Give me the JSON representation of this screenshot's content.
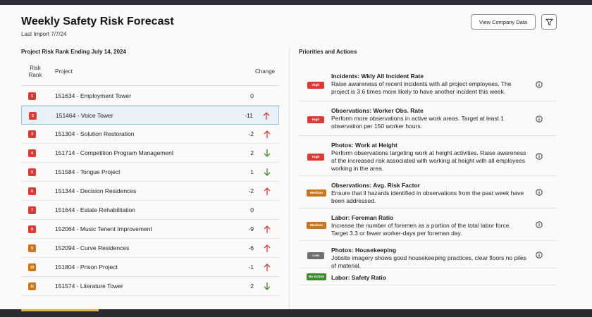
{
  "header": {
    "title": "Weekly Safety Risk Forecast",
    "subtitle": "Last Import 7/7/24",
    "company_button": "View Company Data",
    "filter_icon": "filter-icon"
  },
  "left": {
    "title": "Project Risk Rank Ending July 14, 2024",
    "col_rank_line1": "Risk",
    "col_rank_line2": "Rank",
    "col_project": "Project",
    "col_change": "Change",
    "rows": [
      {
        "rank": "1",
        "project": "151634 - Employment Tower",
        "change": "0",
        "trend": "none",
        "color": "#d93b36"
      },
      {
        "rank": "2",
        "project": "151464 - Voice Tower",
        "change": "-11",
        "trend": "up",
        "color": "#d93b36"
      },
      {
        "rank": "3",
        "project": "151304 - Solution Restoration",
        "change": "-2",
        "trend": "up",
        "color": "#d93b36"
      },
      {
        "rank": "4",
        "project": "151714 - Competition Program Management",
        "change": "2",
        "trend": "down",
        "color": "#d93b36"
      },
      {
        "rank": "5",
        "project": "151584 - Tongue Project",
        "change": "1",
        "trend": "down",
        "color": "#d93b36"
      },
      {
        "rank": "6",
        "project": "151344 - Decision Residences",
        "change": "-2",
        "trend": "up",
        "color": "#d93b36"
      },
      {
        "rank": "7",
        "project": "151644 - Estate Rehabilitation",
        "change": "0",
        "trend": "none",
        "color": "#d93b36"
      },
      {
        "rank": "8",
        "project": "152064 - Music Tenent Improvement",
        "change": "-9",
        "trend": "up",
        "color": "#d93b36"
      },
      {
        "rank": "9",
        "project": "152094 - Curve Residences",
        "change": "-6",
        "trend": "up",
        "color": "#c9761d"
      },
      {
        "rank": "10",
        "project": "151804 - Prison Project",
        "change": "-1",
        "trend": "up",
        "color": "#c9761d"
      },
      {
        "rank": "11",
        "project": "151574 - Literature Tower",
        "change": "2",
        "trend": "down",
        "color": "#c9761d"
      }
    ],
    "selected_index": 1
  },
  "right": {
    "title": "Priorities and Actions",
    "items": [
      {
        "priority": "High",
        "color": "#d93b36",
        "title": "Incidents: Wkly All Incident Rate",
        "desc": "Raise awareness of recent incidents with all project employees. The project is 3.6 times more likely to have another incident this week.",
        "info_icon": "info-icon"
      },
      {
        "priority": "High",
        "color": "#d93b36",
        "title": "Observations: Worker Obs. Rate",
        "desc": "Perform more observations in active work areas. Target at least 1 observation per 150 worker hours.",
        "info_icon": "info-icon"
      },
      {
        "priority": "High",
        "color": "#d93b36",
        "title": "Photos: Work at Height",
        "desc": "Perform observations targeting work at height activities. Raise awareness of the increased risk associated with working at height with all employees working in the area.",
        "info_icon": "info-icon"
      },
      {
        "priority": "Medium",
        "color": "#c9761d",
        "title": "Observations: Avg. Risk Factor",
        "desc": "Ensure that ll hazards identified in observations from the past week have been addressed.",
        "info_icon": "info-icon"
      },
      {
        "priority": "Medium",
        "color": "#c9761d",
        "title": "Labor: Foreman Ratio",
        "desc": "Increase the number of foremen as a portion of the total labor force. Target 3.3 or fewer worker-days per foreman day.",
        "info_icon": "info-icon"
      },
      {
        "priority": "Low",
        "color": "#6f6f6f",
        "title": "Photos: Housekeeping",
        "desc": "Jobsite imagery shows good housekeeping practices, clear floors no piles of material.",
        "info_icon": "info-icon"
      },
      {
        "priority": "No Action",
        "color": "#3f8a2e",
        "title": "Labor: Safety Ratio",
        "desc": "",
        "info_icon": ""
      }
    ]
  },
  "colors": {
    "up_arrow": "#d93b36",
    "down_arrow": "#3f8a2e"
  }
}
